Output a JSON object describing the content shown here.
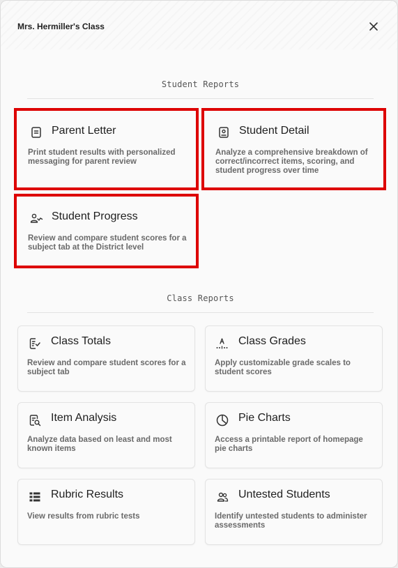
{
  "modal": {
    "title": "Mrs. Hermiller's Class"
  },
  "student_reports": {
    "heading": "Student Reports",
    "cards": [
      {
        "title": "Parent Letter",
        "icon": "document-icon",
        "description": "Print student results with personalized messaging for parent review",
        "highlighted": true
      },
      {
        "title": "Student Detail",
        "icon": "id-badge-icon",
        "description": "Analyze a comprehensive breakdown of correct/incorrect items, scoring, and student progress over time",
        "highlighted": true
      },
      {
        "title": "Student Progress",
        "icon": "user-trend-icon",
        "description": "Review and compare student scores for a subject tab at the District level",
        "highlighted": true
      }
    ]
  },
  "class_reports": {
    "heading": "Class Reports",
    "cards": [
      {
        "title": "Class Totals",
        "icon": "list-check-icon",
        "description": "Review and compare student scores for a subject tab"
      },
      {
        "title": "Class Grades",
        "icon": "grade-scale-icon",
        "description": "Apply customizable grade scales to student scores"
      },
      {
        "title": "Item Analysis",
        "icon": "document-search-icon",
        "description": "Analyze data based on least and most known items"
      },
      {
        "title": "Pie Charts",
        "icon": "pie-chart-icon",
        "description": "Access a printable report of homepage pie charts"
      },
      {
        "title": "Rubric Results",
        "icon": "grid-list-icon",
        "description": "View results from rubric tests"
      },
      {
        "title": "Untested Students",
        "icon": "users-icon",
        "description": "Identify untested students to administer assessments"
      }
    ]
  },
  "colors": {
    "highlight_border": "#dd0000",
    "background": "#fafafa"
  }
}
